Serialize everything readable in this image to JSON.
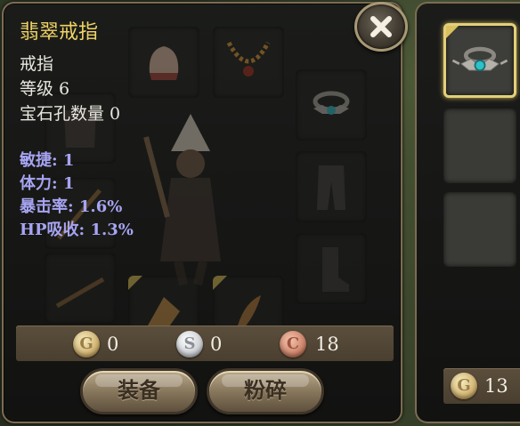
{
  "item": {
    "name": "翡翠戒指",
    "type": "戒指",
    "level": "等级 6",
    "sockets": "宝石孔数量 0",
    "stats": [
      "敏捷: 1",
      "体力: 1",
      "暴击率: 1.6%",
      "HP吸收: 1.3%"
    ]
  },
  "currency": {
    "gold_symbol": "G",
    "gold": "0",
    "silver_symbol": "S",
    "silver": "0",
    "copper_symbol": "C",
    "copper": "18"
  },
  "buttons": {
    "equip": "装备",
    "smash": "粉碎"
  },
  "inventory": {
    "gold_symbol": "G",
    "gold": "13"
  },
  "colors": {
    "title": "#f0d465",
    "stat": "#a7a4f2",
    "frame": "#7c6c52",
    "selected_border": "#e3cf7a"
  },
  "icons": {
    "close": "close-x-icon",
    "ring": "emerald-ring-icon"
  }
}
